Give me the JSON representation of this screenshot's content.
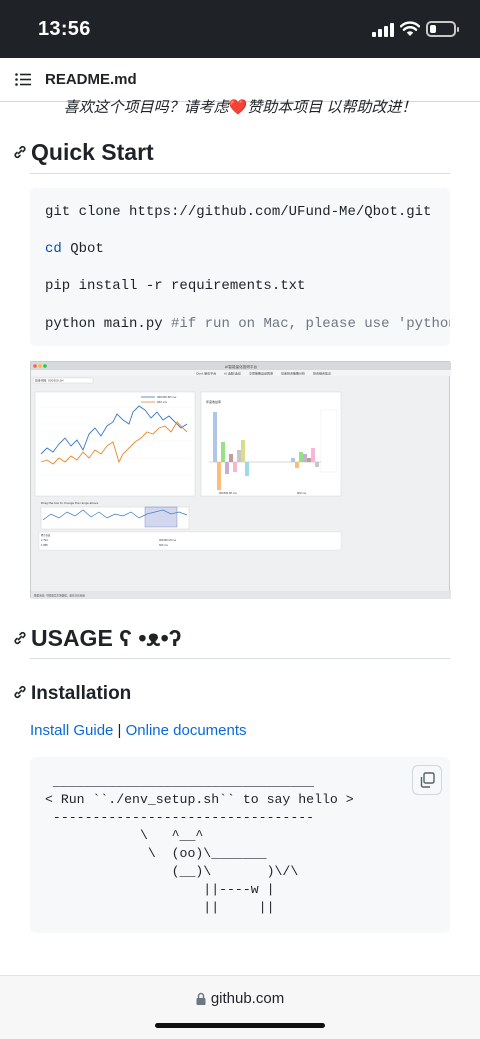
{
  "status_bar": {
    "time": "13:56",
    "battery_level": 0.2
  },
  "file_header": {
    "icon": "list-icon",
    "filename": "README.md"
  },
  "promo": {
    "text_before": "喜欢这个项目吗？请考虑",
    "heart": "❤️",
    "text_after": "赞助本项目 以帮助改进！"
  },
  "sections": {
    "quick_start": "Quick Start",
    "usage": "USAGE ʕ •ᴥ•ʔ",
    "installation": "Installation"
  },
  "quick_start_code": {
    "line1": "git clone https://github.com/UFund-Me/Qbot.git",
    "line2_kw": "cd",
    "line2_rest": " Qbot",
    "line3": "pip install -r requirements.txt",
    "line4_cmd": "python main.py ",
    "line4_comment": "#if run on Mac, please use 'pythonw main.py'"
  },
  "screenshot": {
    "window_title": "AI智能量化投研平台",
    "tabs": [
      "Qbot 量化平台",
      "AI 选股/选基",
      "交易策略自动回测",
      "基金投资策略分析",
      "投资组合建议"
    ],
    "fund_label": "基金代码: 000300.SH",
    "slider_hint": "Drag the box to change the range above.",
    "legend_a": "000300.SH.csv",
    "legend_b": "SPX.csv",
    "bar_chart_title": "年度收益率",
    "bar_years": [
      "2006",
      "2007",
      "2008",
      "2009",
      "2010",
      "2011",
      "2012",
      "2013",
      "2014",
      "2015",
      "2016",
      "2017",
      "2018",
      "2019"
    ],
    "bar_x_labels": [
      "000300.SH.csv",
      "SPX.csv"
    ],
    "status_text": "数据来源: 中国股票市场数据，量化分析系统",
    "table_headers": [
      "#",
      "累计收益",
      "年化收益",
      "波动率",
      "最大回撤",
      "夏普比率",
      "名称"
    ],
    "table_rows": [
      [
        "1",
        "1.794",
        "0.07",
        "0.276",
        "0.394",
        "-0.722",
        "0.087",
        "000300.SH.csv"
      ],
      [
        "2",
        "1.888",
        "0.079",
        "0.21",
        "0.148",
        "-0.338",
        "0.136",
        "SPX.csv"
      ]
    ]
  },
  "install_links": {
    "guide": "Install Guide",
    "separator": " | ",
    "docs": "Online documents"
  },
  "ascii_art": " _________________________________\n< Run ``./env_setup.sh`` to say hello >\n ---------------------------------\n            \\   ^__^\n             \\  (oo)\\_______\n                (__)\\       )\\/\\\n                    ||----w |\n                    ||     ||",
  "copy_button": {
    "icon": "copy-icon"
  },
  "browser": {
    "url": "github.com",
    "icon": "lock-icon"
  }
}
